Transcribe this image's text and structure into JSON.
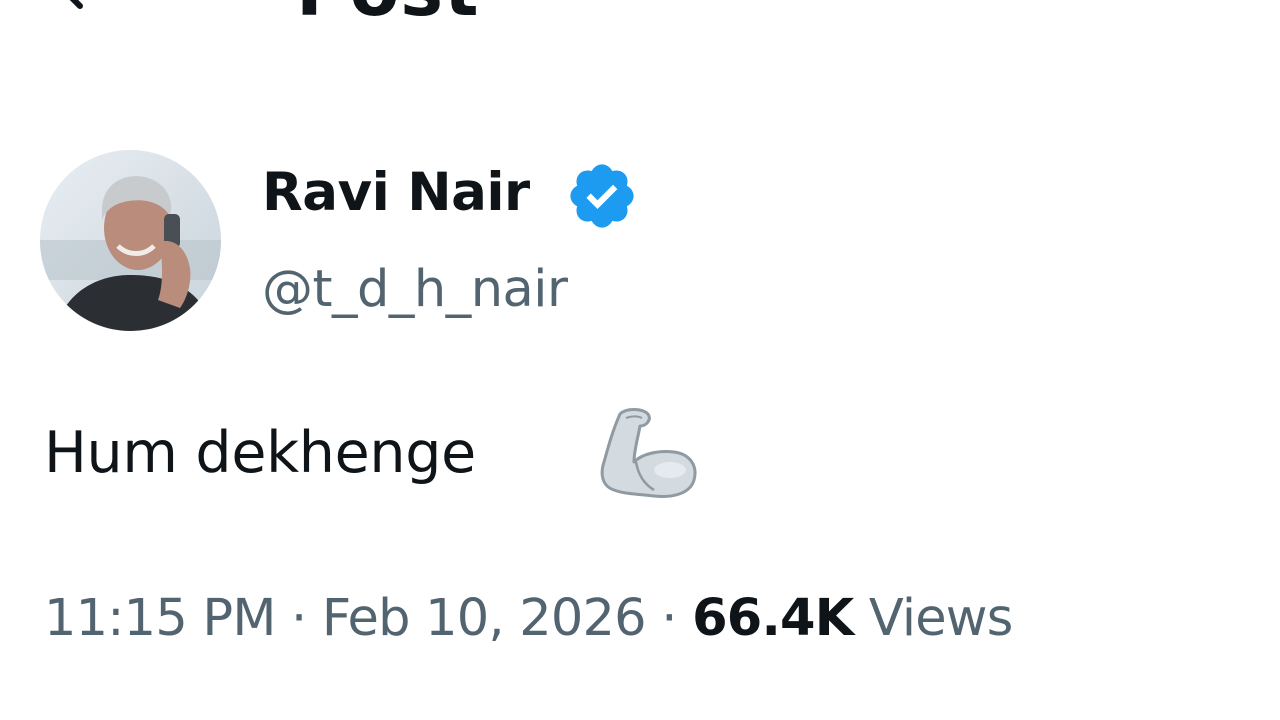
{
  "header": {
    "title": "Post",
    "back_icon": "arrow-left-icon"
  },
  "author": {
    "display_name": "Ravi Nair",
    "handle": "@t_d_h_nair",
    "verified": true,
    "verified_icon": "verified-badge-icon",
    "avatar": "profile-photo"
  },
  "post": {
    "text": "Hum dekhenge",
    "emoji_icon": "flexed-biceps-icon"
  },
  "meta": {
    "time": "11:15 PM",
    "separator": "·",
    "date": "Feb 10, 2026",
    "views_count": "66.4K",
    "views_label": "Views"
  },
  "colors": {
    "text_primary": "#0f1419",
    "text_secondary": "#536471",
    "verified_blue": "#1d9bf0",
    "background": "#ffffff"
  }
}
